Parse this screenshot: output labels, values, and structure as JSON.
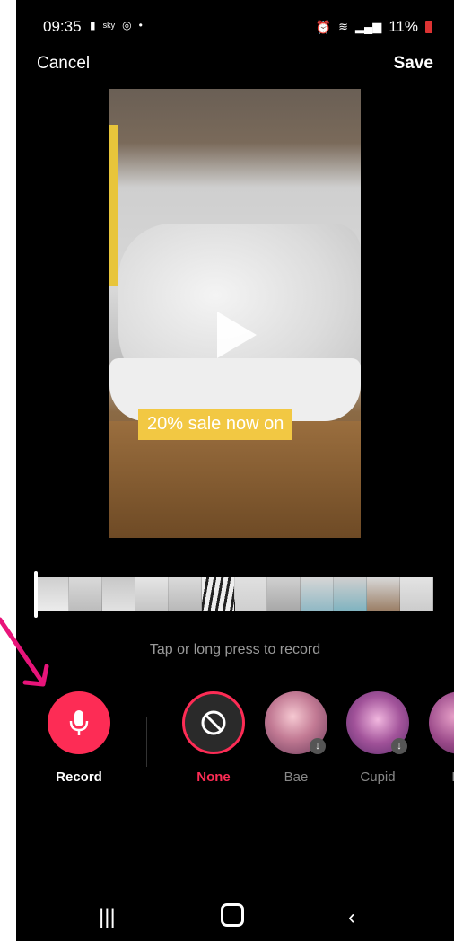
{
  "status_bar": {
    "time": "09:35",
    "left_icons": [
      "notification-icon",
      "sky-news-icon",
      "instagram-icon",
      "dot-icon"
    ],
    "battery": "11%",
    "right_icons": [
      "alarm-icon",
      "wifi-icon",
      "signal-icon",
      "battery-icon"
    ]
  },
  "topbar": {
    "cancel_label": "Cancel",
    "save_label": "Save"
  },
  "preview": {
    "overlay_text": "20% sale now on",
    "play_icon": "play-icon"
  },
  "timeline": {
    "frame_count": 12
  },
  "hint": "Tap or long press to record",
  "effects": [
    {
      "label": "Record",
      "icon": "microphone-icon",
      "accent": "#fd2c55"
    },
    {
      "label": "None",
      "icon": "no-symbol-icon",
      "accent": "#fd2c55"
    },
    {
      "label": "Bae",
      "icon": "bae-avatar"
    },
    {
      "label": "Cupid",
      "icon": "cupid-avatar"
    },
    {
      "label": "Da",
      "icon": "partial-avatar"
    }
  ],
  "navbar": {
    "recents": "recents-icon",
    "home": "home-icon",
    "back": "back-icon"
  },
  "colors": {
    "accent": "#fd2c55",
    "background": "#000000",
    "overlay_label_bg": "#f2c843",
    "arrow": "#e8147a"
  }
}
